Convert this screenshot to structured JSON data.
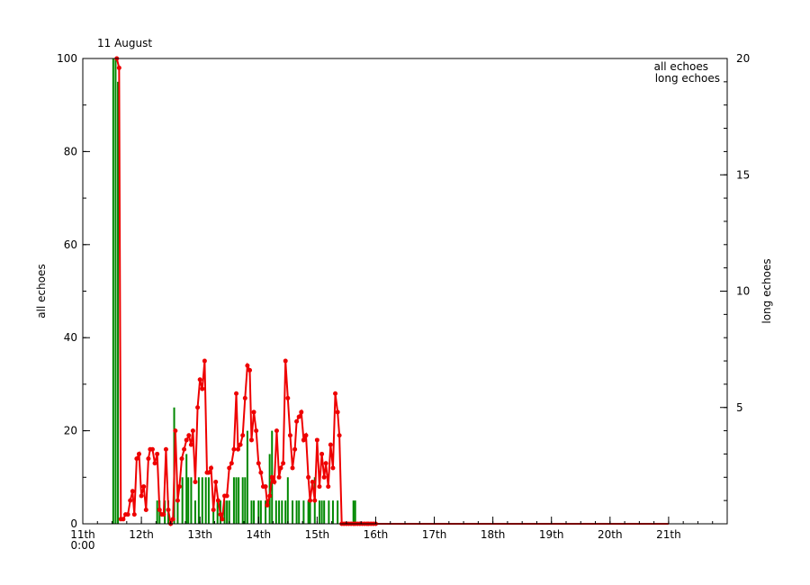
{
  "chart_data": {
    "type": "line",
    "title": "11 August",
    "ylabel_left": "all echoes",
    "ylabel_right": "long echoes",
    "x_ticks": [
      {
        "label": "11th",
        "sub": "0:00",
        "day": 0
      },
      {
        "label": "12th",
        "day": 1
      },
      {
        "label": "13th",
        "day": 2
      },
      {
        "label": "14th",
        "day": 3
      },
      {
        "label": "15th",
        "day": 4
      },
      {
        "label": "16th",
        "day": 5
      },
      {
        "label": "17th",
        "day": 6
      },
      {
        "label": "18th",
        "day": 7
      },
      {
        "label": "19th",
        "day": 8
      },
      {
        "label": "20th",
        "day": 9
      },
      {
        "label": "21th",
        "day": 10
      }
    ],
    "xlim": [
      0,
      11
    ],
    "ylim_left": [
      0,
      100
    ],
    "ylim_right": [
      0,
      20
    ],
    "yticks_left": [
      "0",
      "20",
      "40",
      "60",
      "80",
      "100"
    ],
    "yticks_right": [
      "5",
      "10",
      "15",
      "20"
    ],
    "legend": [
      {
        "label": "all echoes",
        "color": "#ee0000"
      },
      {
        "label": "long echoes",
        "color": "#008800"
      }
    ],
    "legend_position": "top-right",
    "series": [
      {
        "name": "all echoes",
        "color": "#ee0000",
        "axis": "left",
        "style": "line-markers",
        "x": [
          0.58,
          0.62,
          0.65,
          0.69,
          0.73,
          0.77,
          0.81,
          0.85,
          0.88,
          0.92,
          0.96,
          1.0,
          1.04,
          1.08,
          1.12,
          1.15,
          1.19,
          1.23,
          1.27,
          1.31,
          1.35,
          1.38,
          1.42,
          1.46,
          1.5,
          1.54,
          1.58,
          1.62,
          1.65,
          1.69,
          1.73,
          1.77,
          1.81,
          1.85,
          1.88,
          1.92,
          1.96,
          2.0,
          2.04,
          2.08,
          2.12,
          2.15,
          2.19,
          2.23,
          2.27,
          2.31,
          2.35,
          2.38,
          2.42,
          2.46,
          2.5,
          2.54,
          2.58,
          2.62,
          2.65,
          2.69,
          2.73,
          2.77,
          2.81,
          2.85,
          2.88,
          2.92,
          2.96,
          3.0,
          3.04,
          3.08,
          3.12,
          3.15,
          3.19,
          3.23,
          3.27,
          3.31,
          3.35,
          3.38,
          3.42,
          3.46,
          3.5,
          3.54,
          3.58,
          3.62,
          3.65,
          3.69,
          3.73,
          3.77,
          3.81,
          3.85,
          3.88,
          3.92,
          3.96,
          4.0,
          4.04,
          4.08,
          4.12,
          4.15,
          4.19,
          4.23,
          4.27,
          4.31,
          4.35,
          4.38,
          4.42,
          4.46,
          4.5,
          4.54,
          4.58,
          4.62,
          4.65,
          4.69,
          4.73,
          4.77,
          4.81,
          4.85,
          4.88,
          4.92,
          4.96,
          5.0,
          5.5,
          6.0,
          7.0,
          8.0,
          9.0,
          10.0
        ],
        "y": [
          100,
          98,
          1,
          1,
          2,
          2,
          5,
          7,
          2,
          14,
          15,
          6,
          8,
          3,
          14,
          16,
          16,
          13,
          15,
          3,
          2,
          2,
          16,
          3,
          0,
          1,
          20,
          5,
          8,
          14,
          16,
          18,
          19,
          17,
          20,
          9,
          25,
          31,
          29,
          35,
          11,
          11,
          12,
          3,
          9,
          5,
          2,
          1,
          6,
          6,
          12,
          13,
          16,
          28,
          16,
          17,
          19,
          27,
          34,
          33,
          18,
          24,
          20,
          13,
          11,
          8,
          8,
          4,
          6,
          10,
          9,
          20,
          10,
          12,
          13,
          35,
          27,
          19,
          12,
          16,
          22,
          23,
          24,
          18,
          19,
          10,
          5,
          9,
          5,
          18,
          8,
          15,
          10,
          13,
          8,
          17,
          12,
          28,
          24,
          19,
          0,
          0,
          0,
          0,
          0,
          0,
          0,
          0,
          0,
          0,
          0,
          0,
          0,
          0,
          0,
          0,
          0,
          0,
          0,
          0,
          0,
          0
        ]
      },
      {
        "name": "long echoes",
        "color": "#008800",
        "axis": "right",
        "style": "bars",
        "x": [
          0.52,
          0.56,
          0.6,
          1.27,
          1.31,
          1.4,
          1.46,
          1.56,
          1.62,
          1.7,
          1.77,
          1.8,
          1.85,
          1.92,
          1.98,
          2.04,
          2.1,
          2.15,
          2.23,
          2.3,
          2.35,
          2.42,
          2.46,
          2.5,
          2.58,
          2.62,
          2.66,
          2.73,
          2.77,
          2.81,
          2.88,
          2.92,
          3.0,
          3.04,
          3.12,
          3.19,
          3.23,
          3.3,
          3.35,
          3.4,
          3.46,
          3.5,
          3.58,
          3.65,
          3.69,
          3.77,
          3.85,
          3.88,
          3.96,
          4.04,
          4.08,
          4.12,
          4.2,
          4.27,
          4.35,
          4.62,
          4.65
        ],
        "values": [
          20,
          20,
          19,
          1,
          1,
          1,
          1,
          5,
          1,
          2,
          3,
          2,
          2,
          1,
          2,
          2,
          2,
          2,
          1,
          1,
          1,
          1,
          1,
          1,
          2,
          2,
          2,
          2,
          2,
          4,
          1,
          1,
          1,
          1,
          1,
          3,
          4,
          1,
          1,
          1,
          1,
          2,
          1,
          1,
          1,
          1,
          1,
          1,
          2,
          1,
          1,
          1,
          1,
          1,
          1,
          1,
          1
        ]
      }
    ]
  }
}
